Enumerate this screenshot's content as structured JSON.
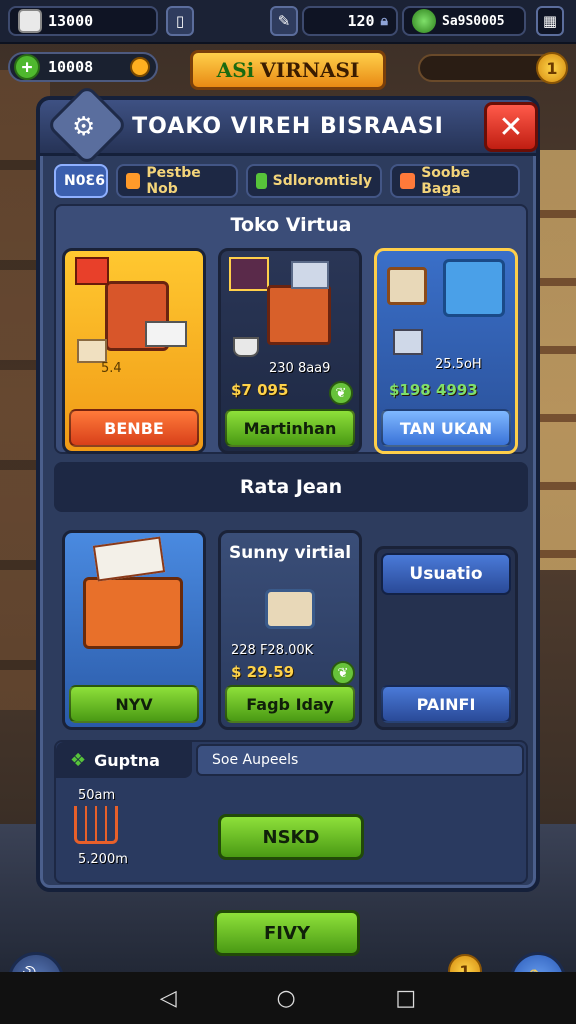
{
  "hud": {
    "left_value": "13000",
    "mid_value": "120",
    "right_value": "Sa9S0005",
    "menu_icon": "grid-icon"
  },
  "coins": {
    "value": "10008",
    "plus": "+"
  },
  "logo": {
    "text": "VIRNASI",
    "prefix": "ASi"
  },
  "xp": {
    "badge": "1"
  },
  "panel": {
    "title": "TOAKO VIREH BISRAASI",
    "close_label": "✕",
    "tabs": [
      {
        "label": "N0Ԑ6",
        "icon_color": "#ffd34a"
      },
      {
        "label": "Pestbe Nob",
        "icon_color": "#ff9a2a"
      },
      {
        "label": "Sdloromtisly",
        "icon_color": "#57c43a"
      },
      {
        "label": "Soobe Baga",
        "icon_color": "#ff7a3a"
      }
    ],
    "section1_title": "Toko Virtua",
    "cards_row1": [
      {
        "sub": "5.4",
        "price": "",
        "button": "BENBE",
        "style": "red"
      },
      {
        "sub": "230 8aa9",
        "price": "$7 095",
        "button": "Martinhan",
        "style": "green"
      },
      {
        "sub": "25.5oH",
        "price": "$198 4993",
        "button": "TAN UKAN",
        "style": "blue"
      }
    ],
    "section2_title": "Rata Jean",
    "cards_row2": [
      {
        "title": "",
        "sub": "",
        "price": "",
        "button": "NYV",
        "style": "green"
      },
      {
        "title": "Sunny virtial",
        "sub": "228 F28.00K",
        "price": "$ 29.59",
        "button": "Fagb Iday",
        "style": "green"
      },
      {
        "title": "Usuatio",
        "sub": "",
        "price": "",
        "button": "PAINFI",
        "style": "blue"
      }
    ],
    "footer": {
      "tab_label": "Guptna",
      "search_label": "Soe Aupeels",
      "cart_top": "50am",
      "cart_bottom": "5.200m",
      "button": "NSKD"
    }
  },
  "bottom_button": "FIVY",
  "corner_badge": "1",
  "nav": {
    "back": "◁",
    "home": "○",
    "recents": "□"
  }
}
